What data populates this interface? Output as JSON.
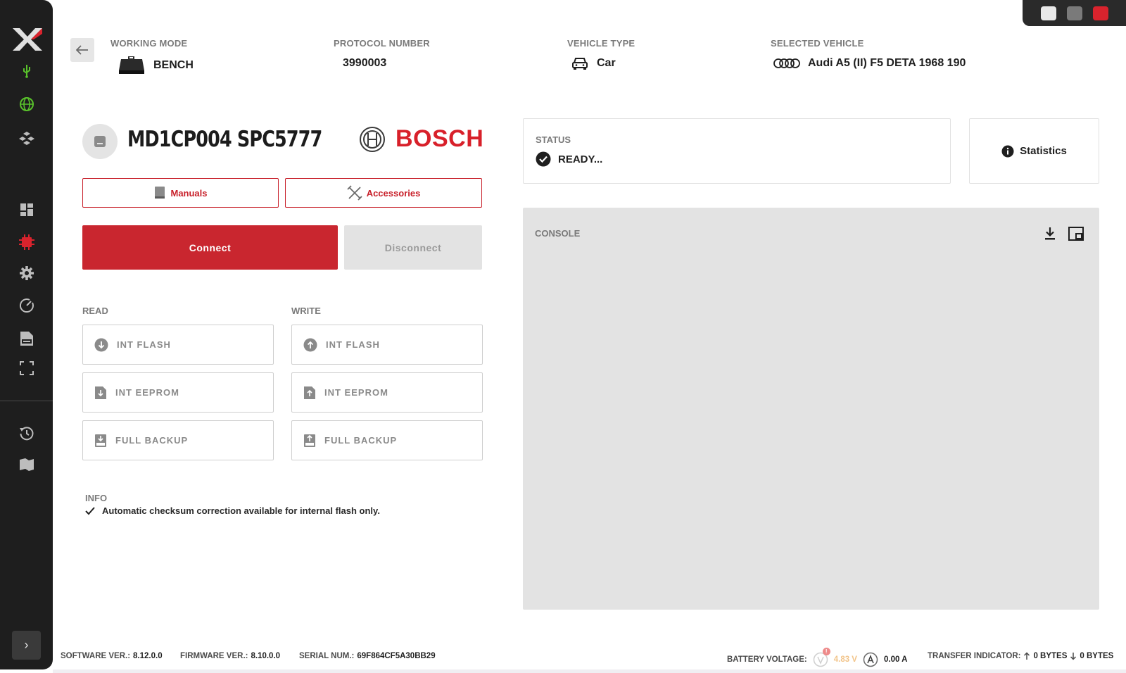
{
  "window": {
    "controls": [
      "minimize",
      "maximize",
      "close"
    ],
    "colors": {
      "minimize": "#e8e8e8",
      "maximize": "#7a7a7a",
      "close": "#d9232d"
    }
  },
  "sidebar": {
    "icons": [
      "x-logo-icon",
      "usb-icon",
      "globe-icon",
      "cubes-icon",
      "dashboard-icon",
      "chip-icon",
      "gear-icon",
      "gauge-icon",
      "log-icon",
      "fullscreen-icon",
      "history-icon",
      "flag-icon"
    ],
    "active_color": "#d9232d",
    "green_color": "#59c12b",
    "expand_label": "›"
  },
  "header": {
    "working_mode": {
      "label": "WORKING MODE",
      "value": "BENCH"
    },
    "protocol_number": {
      "label": "PROTOCOL NUMBER",
      "value": "3990003"
    },
    "vehicle_type": {
      "label": "VEHICLE TYPE",
      "value": "Car"
    },
    "selected_vehicle": {
      "label": "SELECTED VEHICLE",
      "value": "Audi A5 (II) F5 DETA 1968 190"
    }
  },
  "ecu": {
    "name": "MD1CP004 SPC5777",
    "brand": "BOSCH"
  },
  "buttons": {
    "manuals": "Manuals",
    "accessories": "Accessories",
    "connect": "Connect",
    "disconnect": "Disconnect"
  },
  "read": {
    "label": "READ",
    "items": [
      "INT FLASH",
      "INT EEPROM",
      "FULL BACKUP"
    ]
  },
  "write": {
    "label": "WRITE",
    "items": [
      "INT FLASH",
      "INT EEPROM",
      "FULL BACKUP"
    ]
  },
  "info": {
    "label": "INFO",
    "text": "Automatic checksum correction available for internal flash only."
  },
  "status": {
    "label": "STATUS",
    "value": "READY..."
  },
  "statistics": {
    "label": "Statistics"
  },
  "console": {
    "label": "CONSOLE"
  },
  "footer": {
    "software_label": "SOFTWARE VER.:",
    "software_value": "8.12.0.0",
    "firmware_label": "FIRMWARE VER.:",
    "firmware_value": "8.10.0.0",
    "serial_label": "SERIAL NUM.:",
    "serial_value": "69F864CF5A30BB29",
    "battery_label": "BATTERY VOLTAGE:",
    "voltage_value": "4.83 V",
    "voltage_badge": "!",
    "current_value": "0.00 A",
    "transfer_label": "TRANSFER INDICATOR:",
    "upload_value": "0 BYTES",
    "download_value": "0 BYTES"
  }
}
